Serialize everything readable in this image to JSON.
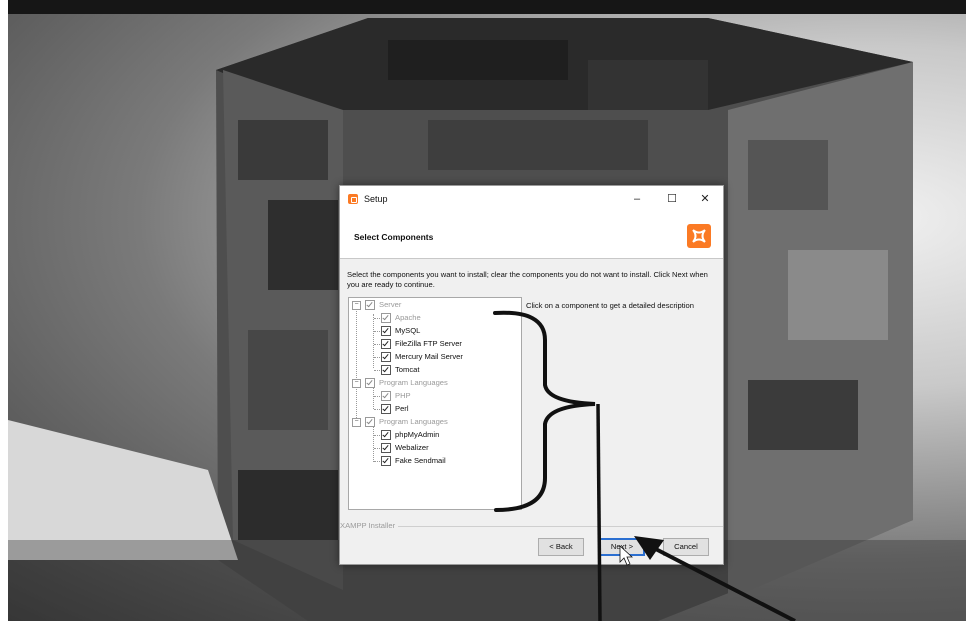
{
  "window": {
    "title": "Setup"
  },
  "header": {
    "title": "Select Components",
    "logo": "xampp-logo-icon"
  },
  "instructions": "Select the components you want to install; clear the components you do not want to install. Click Next when you are ready to continue.",
  "description": "Click on a component to get a detailed description",
  "components": [
    {
      "label": "Server",
      "checked": true,
      "disabled": true
    },
    {
      "label": "Apache",
      "checked": true,
      "disabled": true
    },
    {
      "label": "MySQL",
      "checked": true
    },
    {
      "label": "FileZilla FTP Server",
      "checked": true
    },
    {
      "label": "Mercury Mail Server",
      "checked": true
    },
    {
      "label": "Tomcat",
      "checked": true
    },
    {
      "label": "Program Languages",
      "checked": true,
      "disabled": true
    },
    {
      "label": "PHP",
      "checked": true,
      "disabled": true
    },
    {
      "label": "Perl",
      "checked": true
    },
    {
      "label": "Program Languages",
      "checked": true,
      "disabled": true
    },
    {
      "label": "phpMyAdmin",
      "checked": true
    },
    {
      "label": "Webalizer",
      "checked": true
    },
    {
      "label": "Fake Sendmail",
      "checked": true
    }
  ],
  "footer": {
    "installer_label": "XAMPP Installer",
    "back": "< Back",
    "next": "Next >",
    "cancel": "Cancel"
  },
  "colors": {
    "accent": "#fb7a24",
    "default_button_border": "#2b6fd1"
  }
}
